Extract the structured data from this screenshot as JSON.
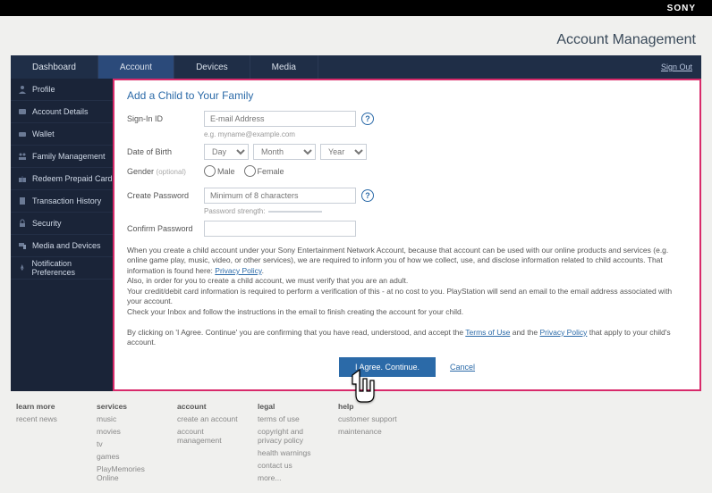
{
  "brand": "SONY",
  "header": {
    "title": "Account Management",
    "signout": "Sign Out"
  },
  "tabs": [
    "Dashboard",
    "Account",
    "Devices",
    "Media"
  ],
  "active_tab": 1,
  "sidebar": [
    {
      "icon": "person",
      "label": "Profile"
    },
    {
      "icon": "card",
      "label": "Account Details"
    },
    {
      "icon": "wallet",
      "label": "Wallet"
    },
    {
      "icon": "family",
      "label": "Family Management"
    },
    {
      "icon": "gift",
      "label": "Redeem Prepaid Card"
    },
    {
      "icon": "history",
      "label": "Transaction History"
    },
    {
      "icon": "lock",
      "label": "Security"
    },
    {
      "icon": "devices",
      "label": "Media and Devices"
    },
    {
      "icon": "bell",
      "label": "Notification Preferences"
    }
  ],
  "form": {
    "title": "Add a Child to Your Family",
    "signin_label": "Sign-In ID",
    "signin_placeholder": "E-mail Address",
    "signin_hint": "e.g. myname@example.com",
    "dob_label": "Date of Birth",
    "dob_day": "Day",
    "dob_month": "Month",
    "dob_year": "Year",
    "gender_label": "Gender",
    "gender_optional": "(optional)",
    "gender_male": "Male",
    "gender_female": "Female",
    "pw_label": "Create Password",
    "pw_placeholder": "Minimum of 8 characters",
    "pw_strength_label": "Password strength:",
    "cpw_label": "Confirm Password",
    "disclaimer1a": "When you create a child account under your Sony Entertainment Network Account, because that account can be used with our online products and services (e.g. online game play, music, video, or other services), we are required to inform you of how we collect, use, and disclose information related to child accounts. That information is found here: ",
    "privacy_link": "Privacy Policy",
    "disclaimer2": "Also, in order for you to create a child account, we must verify that you are an adult.",
    "disclaimer3": "Your credit/debit card information is required to perform a verification of this - at no cost to you. PlayStation will send an email to the email address associated with your account.",
    "disclaimer4": "Check your Inbox and follow the instructions in the email to finish creating the account for your child.",
    "disclaimer5a": "By clicking on 'I Agree. Continue' you are confirming that you have read, understood, and accept the ",
    "terms_link": "Terms of Use",
    "disclaimer5b": " and the ",
    "disclaimer5c": " that apply to your child's account.",
    "agree_btn": "I Agree. Continue.",
    "cancel": "Cancel"
  },
  "footer": {
    "cols": [
      {
        "h": "learn more",
        "items": [
          "recent news"
        ]
      },
      {
        "h": "services",
        "items": [
          "music",
          "movies",
          "tv",
          "games",
          "PlayMemories Online"
        ]
      },
      {
        "h": "account",
        "items": [
          "create an account",
          "account management"
        ]
      },
      {
        "h": "legal",
        "items": [
          "terms of use",
          "copyright and privacy policy",
          "health warnings",
          "contact us",
          "more..."
        ]
      },
      {
        "h": "help",
        "items": [
          "customer support",
          "maintenance"
        ]
      }
    ]
  }
}
